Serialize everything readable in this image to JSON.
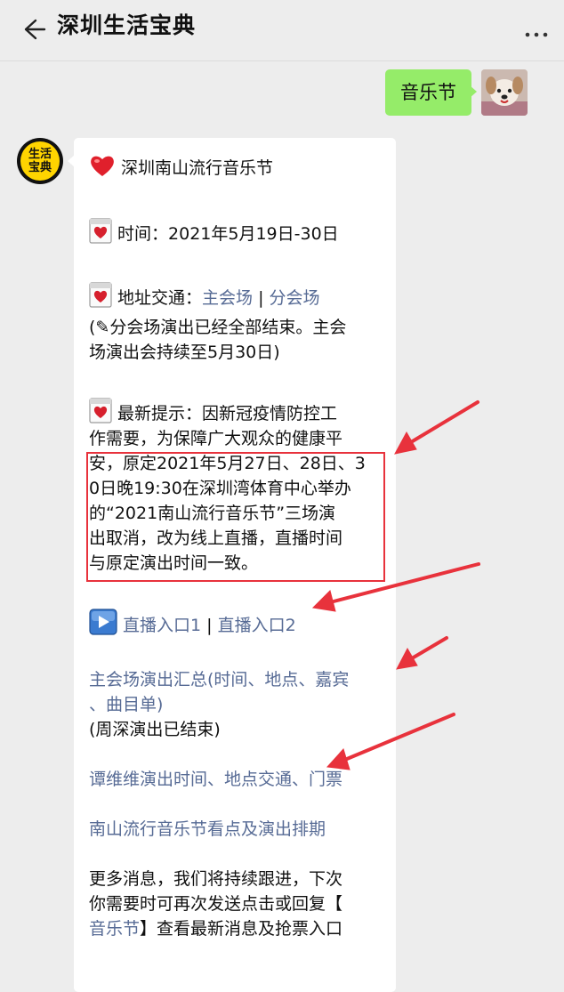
{
  "header": {
    "title": "深圳生活宝典"
  },
  "user_message": {
    "text": "音乐节"
  },
  "bot_avatar": {
    "line1": "生活",
    "line2": "宝典"
  },
  "message": {
    "title": "深圳南山流行音乐节",
    "time_label": "时间：",
    "time_value": "2021年5月19日-30日",
    "address_label": "地址交通：",
    "main_venue": "主会场",
    "separator1": " | ",
    "sub_venue": "分会场",
    "note_line1": "(✎分会场演出已经全部结束。主会",
    "note_line2": "场演出会持续至5月30日)",
    "tip_line1": "最新提示：因新冠疫情防控工",
    "tip_line2": "作需要，为保障广大观众的健康平",
    "tip_line3": "安，原定2021年5月27日、28日、3",
    "tip_line4": "0日晚19:30在深圳湾体育中心举办",
    "tip_line5": "的“2021南山流行音乐节”三场演",
    "tip_line6": "出取消，改为线上直播，直播时间",
    "tip_line7": "与原定演出时间一致。",
    "live1": "直播入口1",
    "separator2": " | ",
    "live2": "直播入口2",
    "summary_line1": "主会场演出汇总(时间、地点、嘉宾",
    "summary_line2": "、曲目单)",
    "summary_note": "(周深演出已结束)",
    "tan_link": "谭维维演出时间、地点交通、门票",
    "highlights_link": "南山流行音乐节看点及演出排期",
    "more_line1": "更多消息，我们将持续跟进，下次",
    "more_line2": "你需要时可再次发送点击或回复【",
    "more_link": "音乐节",
    "more_line3_rest": "】查看最新消息及抢票入口"
  },
  "colors": {
    "link": "#576b95",
    "user_bubble": "#95ec69",
    "annotation_red": "#e8323c",
    "background": "#ededed"
  },
  "icons": [
    "back-arrow-icon",
    "more-dots-icon",
    "heart-icon",
    "calendar-icon",
    "play-icon",
    "pencil-icon"
  ]
}
